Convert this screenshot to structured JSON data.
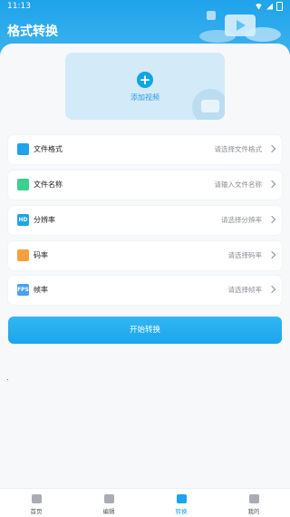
{
  "status_bar": {
    "time": "11:13"
  },
  "header": {
    "title": "格式转换"
  },
  "upload": {
    "label": "添加视频"
  },
  "settings": [
    {
      "id": "format",
      "label": "文件格式",
      "value": "请选择文件格式",
      "icon": "file-format-icon",
      "color": "#1fa3ea",
      "glyph": ""
    },
    {
      "id": "name",
      "label": "文件名称",
      "value": "请输入文件名称",
      "icon": "file-name-icon",
      "color": "#3ccf8e",
      "glyph": ""
    },
    {
      "id": "resolution",
      "label": "分辨率",
      "value": "请选择分辨率",
      "icon": "hd-icon",
      "color": "#1fa3ea",
      "glyph": "HD"
    },
    {
      "id": "bitrate",
      "label": "码率",
      "value": "请选择码率",
      "icon": "bitrate-icon",
      "color": "#f5a03c",
      "glyph": ""
    },
    {
      "id": "framerate",
      "label": "帧率",
      "value": "请选择帧率",
      "icon": "fps-icon",
      "color": "#4a9ff0",
      "glyph": "FPS"
    }
  ],
  "start_button": "开始转换",
  "tabbar": [
    {
      "label": "首页",
      "icon": "home-icon",
      "active": false
    },
    {
      "label": "编辑",
      "icon": "edit-icon",
      "active": false
    },
    {
      "label": "转换",
      "icon": "convert-icon",
      "active": true
    },
    {
      "label": "我的",
      "icon": "profile-icon",
      "active": false
    }
  ]
}
